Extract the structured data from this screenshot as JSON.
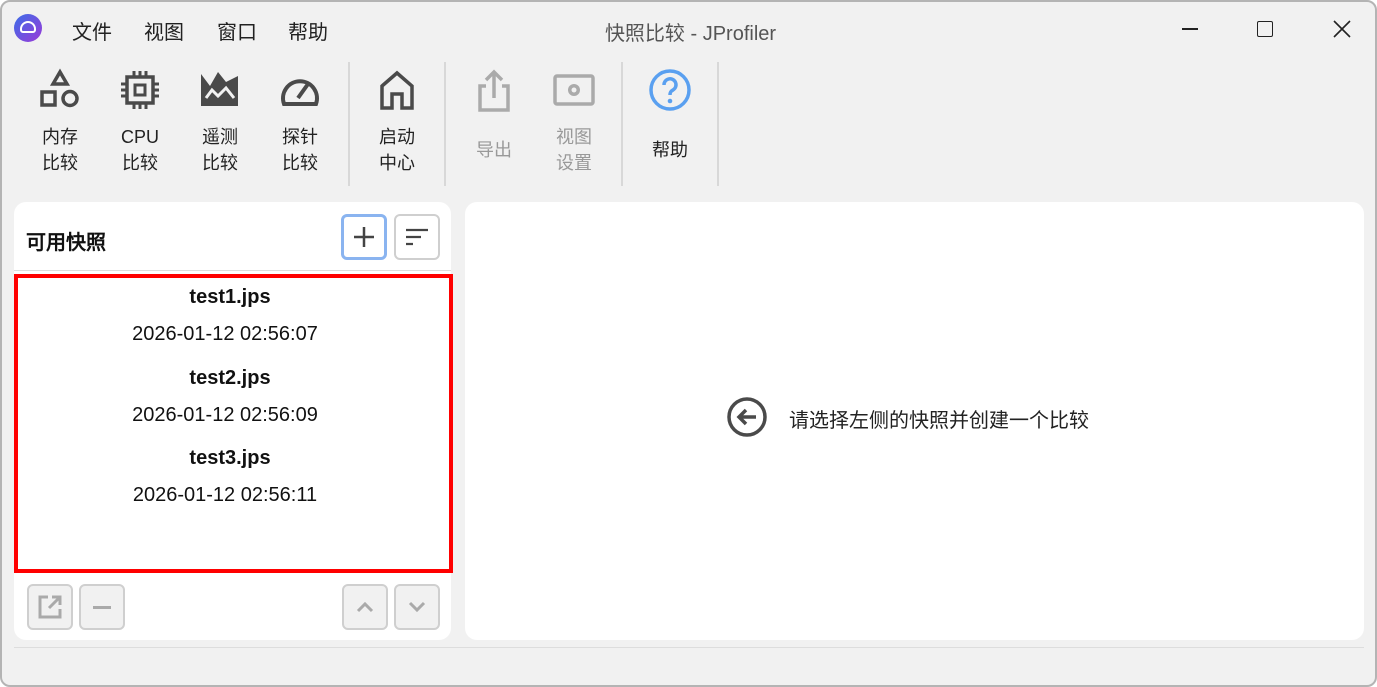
{
  "window": {
    "title": "快照比较 - JProfiler"
  },
  "menu": [
    "文件",
    "视图",
    "窗口",
    "帮助"
  ],
  "toolbar": {
    "memory": [
      "内存",
      "比较"
    ],
    "cpu": [
      "CPU",
      "比较"
    ],
    "telemetry": [
      "遥测",
      "比较"
    ],
    "probe": [
      "探针",
      "比较"
    ],
    "start": [
      "启动",
      "中心"
    ],
    "export": [
      "导出"
    ],
    "view_settings": [
      "视图",
      "设置"
    ],
    "help": [
      "帮助"
    ]
  },
  "snapshots": {
    "title": "可用快照",
    "items": [
      {
        "name": "test1.jps",
        "date": "2026-01-12 02:56:07"
      },
      {
        "name": "test2.jps",
        "date": "2026-01-12 02:56:09"
      },
      {
        "name": "test3.jps",
        "date": "2026-01-12 02:56:11"
      }
    ]
  },
  "main": {
    "message": "请选择左侧的快照并创建一个比较"
  },
  "colors": {
    "highlight": "#ff0000",
    "help": "#5aa0f0",
    "icon": "#4a4a4a",
    "disabled": "#aaaaaa"
  }
}
